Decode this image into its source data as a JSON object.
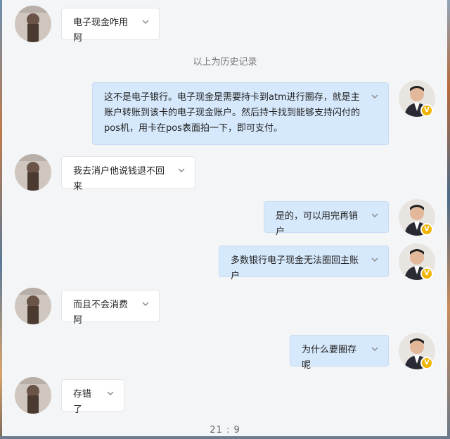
{
  "system_note": "以上为历史记录",
  "timestamp": "21 : 9",
  "colors": {
    "bubble_out": "#d6e8fb",
    "bubble_in": "#ffffff",
    "badge": "#f0b400"
  },
  "messages": [
    {
      "side": "in",
      "text": "电子现金咋用阿"
    },
    {
      "side": "out",
      "text": "这不是电子银行。电子现金是需要持卡到atm进行圈存，就是主账户转账到该卡的电子现金账户。然后持卡找到能够支持闪付的pos机，用卡在pos表面拍一下，即可支付。"
    },
    {
      "side": "in",
      "text": "我去消户他说钱退不回来"
    },
    {
      "side": "out",
      "text": "是的，可以用完再销户"
    },
    {
      "side": "out",
      "text": "多数银行电子现金无法圈回主账户"
    },
    {
      "side": "in",
      "text": "而且不会消费阿"
    },
    {
      "side": "out",
      "text": "为什么要圈存呢"
    },
    {
      "side": "in",
      "text": "存错了"
    }
  ],
  "icons": {
    "expand": "chevron-down-icon",
    "verified": "verified-badge-icon"
  }
}
